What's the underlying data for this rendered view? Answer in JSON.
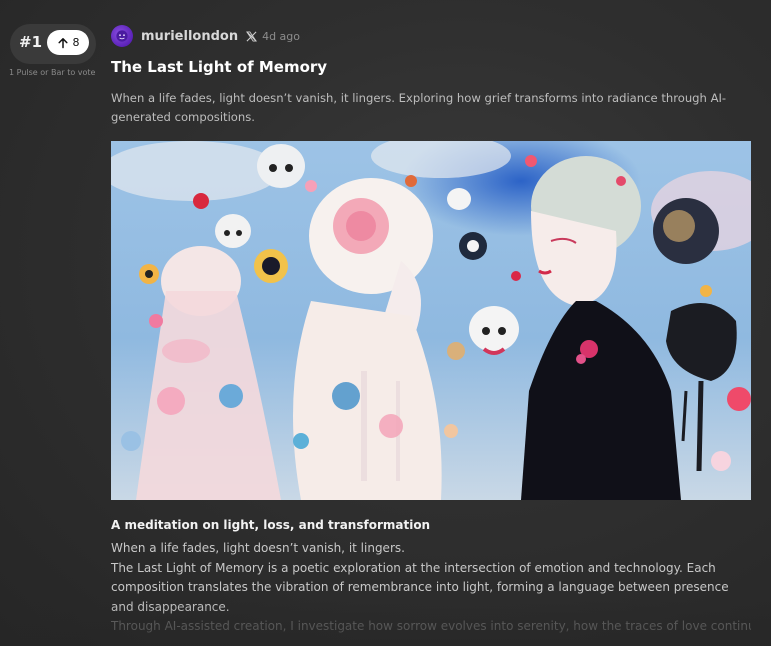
{
  "rank": {
    "label": "#1",
    "votes": "8",
    "hint": "1 Pulse or Bar to vote"
  },
  "author": {
    "name": "muriellondon",
    "time": "4d ago"
  },
  "post": {
    "title": "The Last Light of Memory",
    "subtitle": "When a life fades, light doesn’t vanish, it lingers. Exploring how grief transforms into radiance through AI-generated compositions.",
    "section_heading": "A meditation on light, loss, and transformation",
    "paragraph_1": "When a life fades, light doesn’t vanish, it lingers.",
    "paragraph_2": "The Last Light of Memory is a poetic exploration at the intersection of emotion and technology. Each composition translates the vibration of remembrance into light, forming a language between presence and disappearance.",
    "paragraph_3": "Through AI-assisted creation, I investigate how sorrow evolves into serenity, how the traces of love continue to"
  },
  "colors": {
    "background": "#2f2f2f",
    "vote_pill": "#ffffff",
    "avatar": "#6a2fc8"
  },
  "icons": {
    "vote": "arrow-up-icon",
    "platform": "x-logo-icon"
  }
}
